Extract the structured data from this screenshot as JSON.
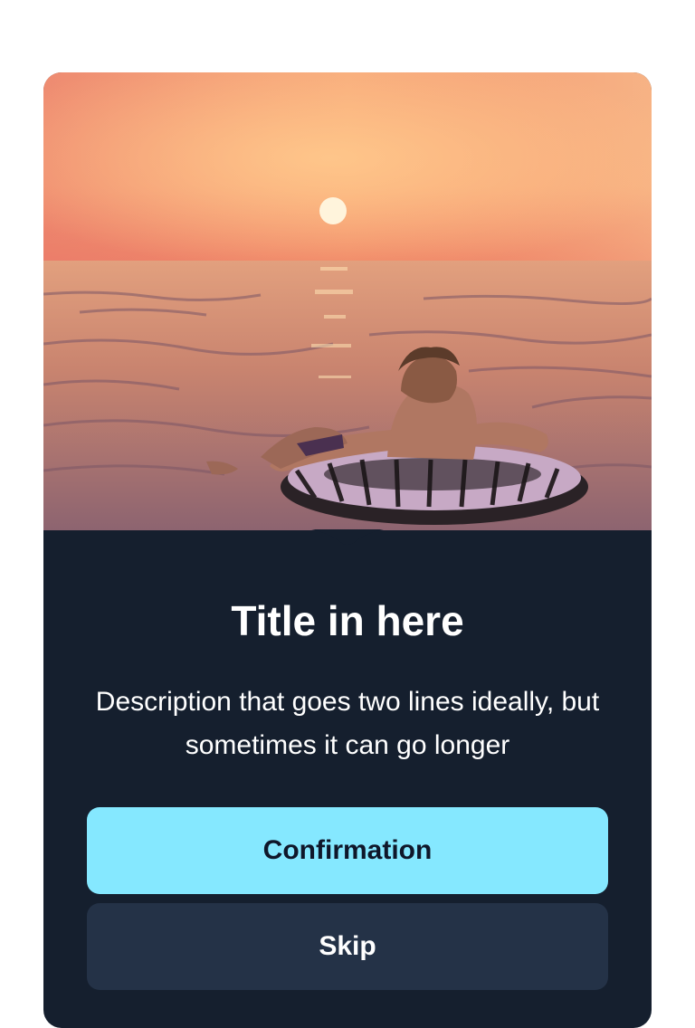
{
  "hero_image": {
    "alt": "Person floating on an inflatable ring in the sea at sunset",
    "colors": {
      "sky_top": "#f5b08a",
      "sky_mid": "#fbb27a",
      "horizon": "#f08a6a",
      "sea": "#d9876f",
      "sea_dark": "#6b4b5a",
      "sun": "#fff4dc"
    }
  },
  "dialog": {
    "title": "Title in here",
    "description": "Description that goes two lines ideally, but sometimes it can go longer",
    "confirm_label": "Confirmation",
    "skip_label": "Skip"
  },
  "colors": {
    "card_bg": "#151f2e",
    "primary_button": "#85e8ff",
    "secondary_button": "#243247"
  }
}
